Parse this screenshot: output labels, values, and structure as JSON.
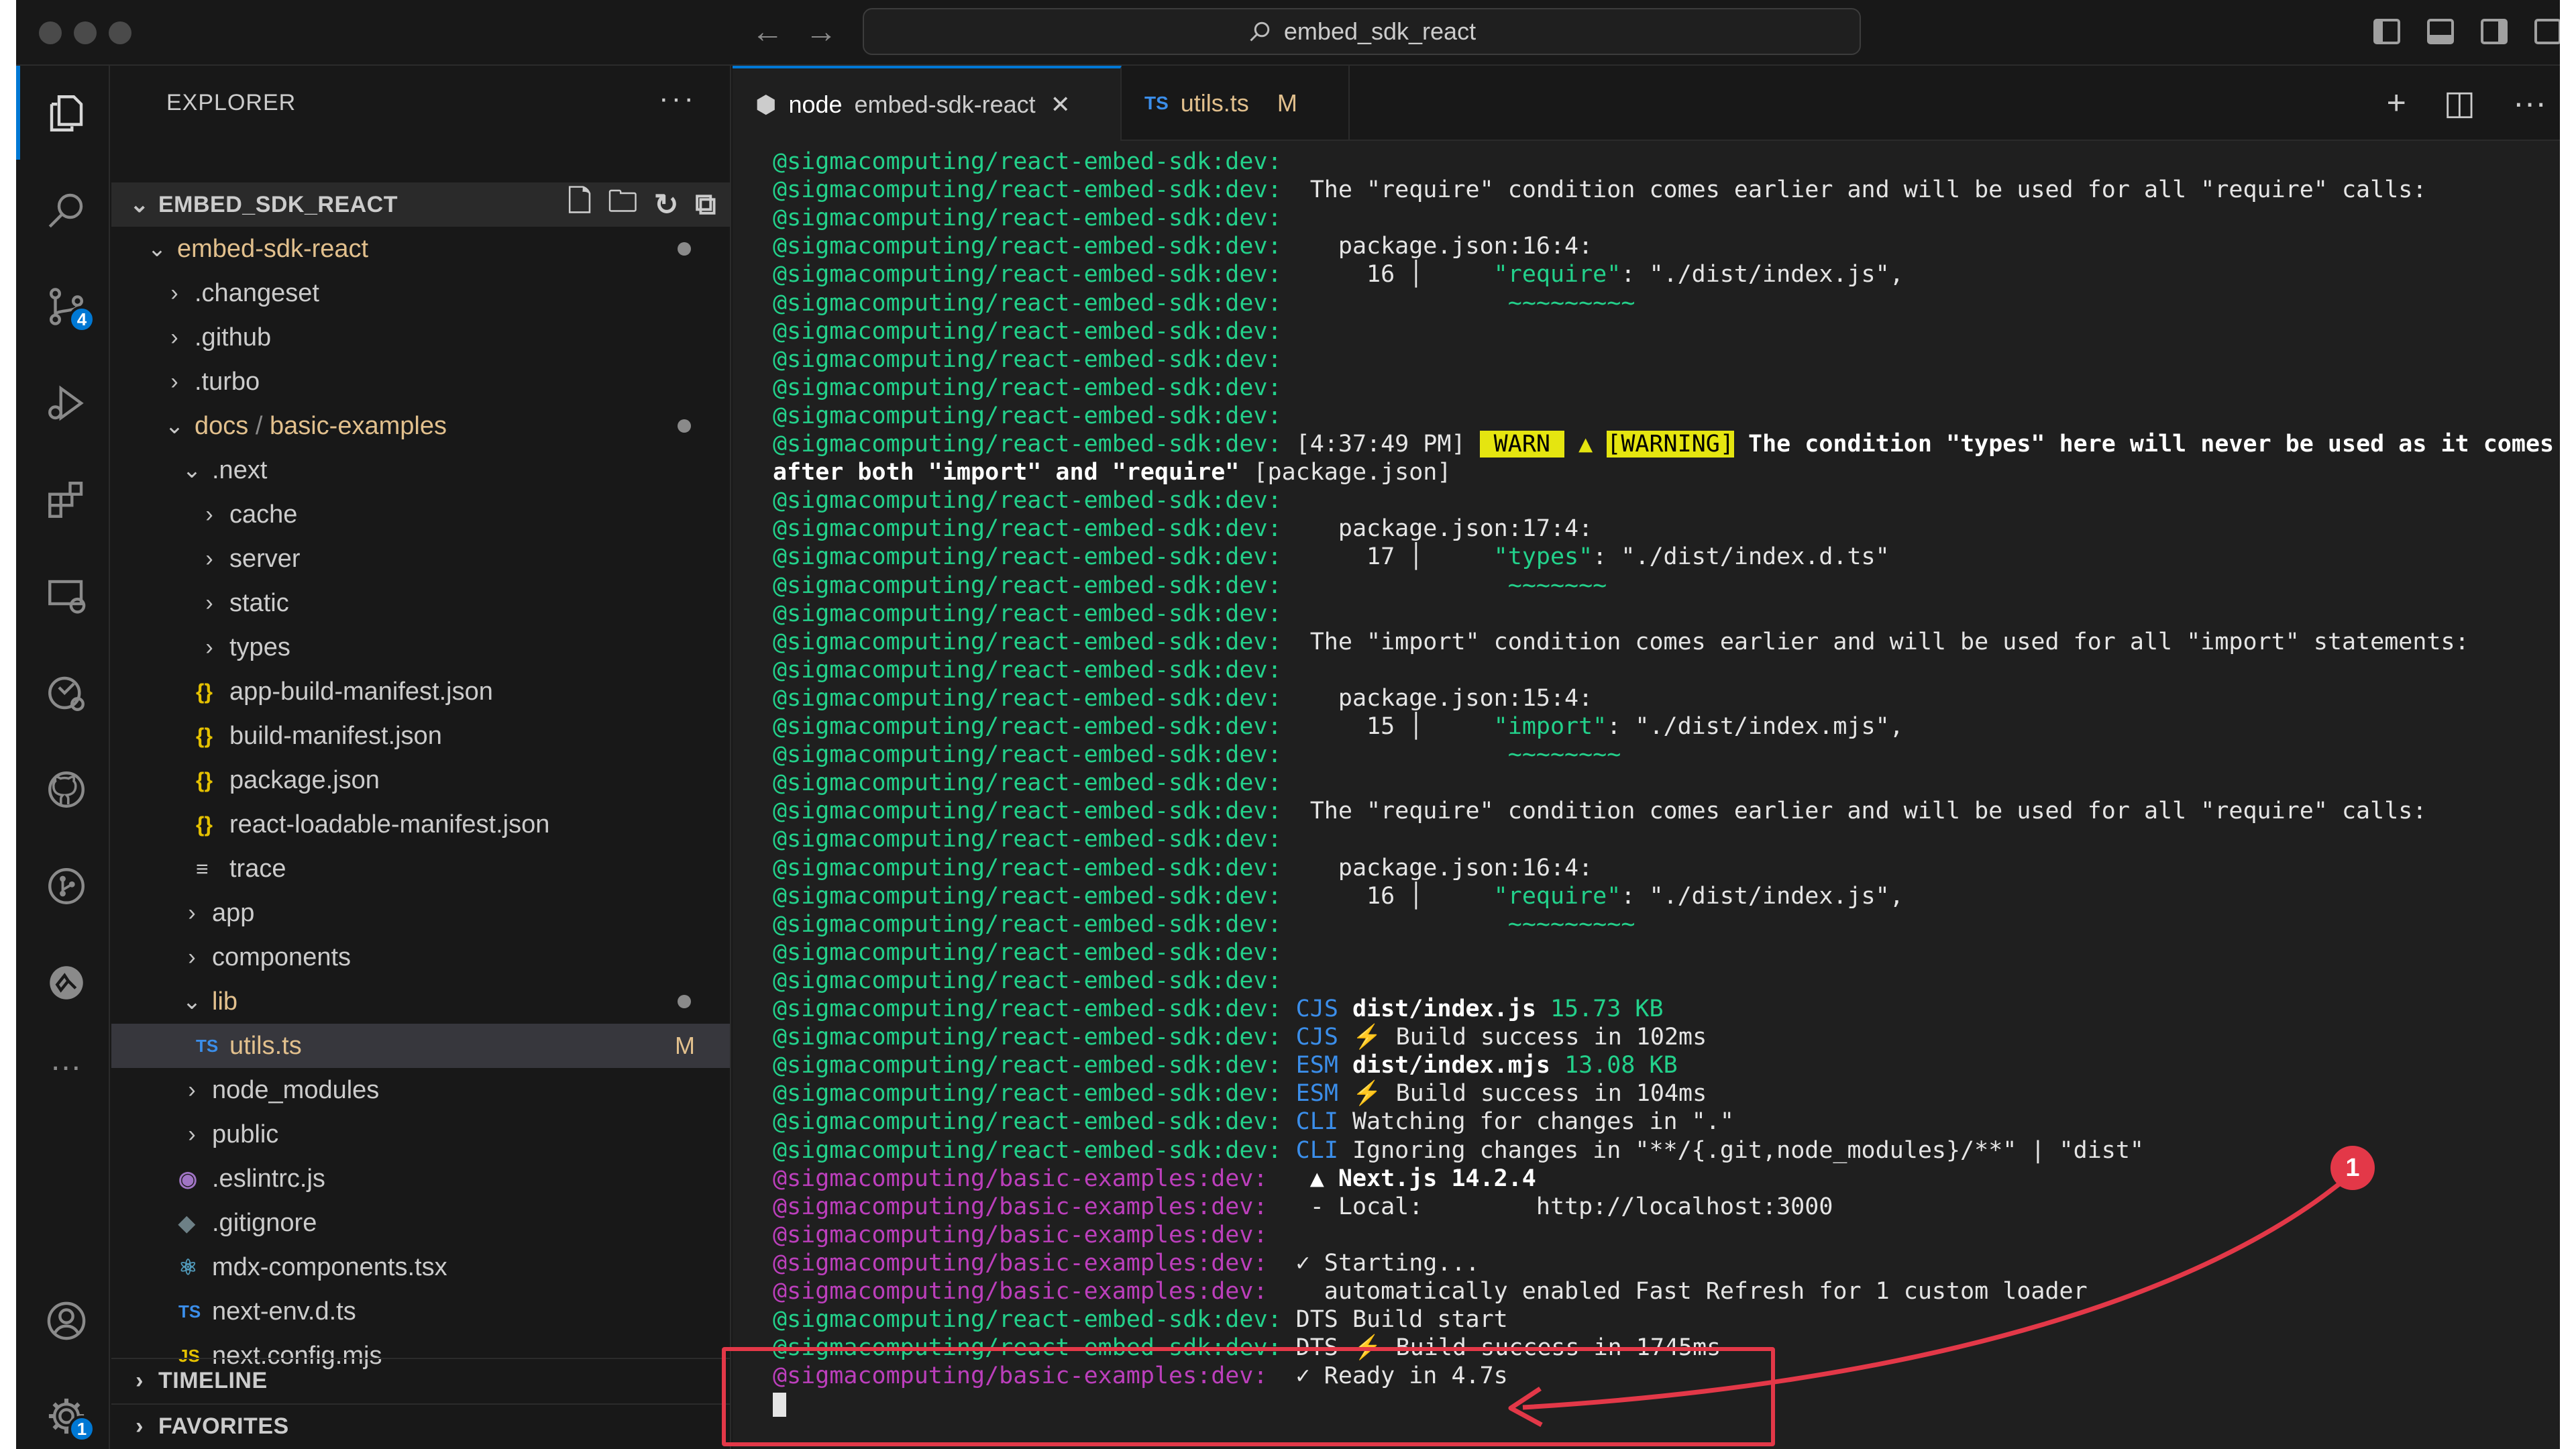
{
  "window": {
    "search_text": "embed_sdk_react"
  },
  "activity_bar": {
    "source_control_badge": "4",
    "settings_badge": "1",
    "more_label": "..."
  },
  "sidebar": {
    "header": "EXPLORER",
    "more": "···",
    "root": "EMBED_SDK_REACT",
    "tree": [
      {
        "label": "embed-sdk-react",
        "chev": "⌄",
        "color": "#e2c08d"
      },
      {
        "label": ".changeset",
        "chev": "›"
      },
      {
        "label": ".github",
        "chev": "›"
      },
      {
        "label": ".turbo",
        "chev": "›"
      },
      {
        "label": "docs",
        "sep": " / ",
        "label2": "basic-examples",
        "chev": "⌄",
        "color": "#e2c08d"
      },
      {
        "label": ".next",
        "chev": "⌄"
      },
      {
        "label": "cache",
        "chev": "›"
      },
      {
        "label": "server",
        "chev": "›"
      },
      {
        "label": "static",
        "chev": "›"
      },
      {
        "label": "types",
        "chev": "›"
      },
      {
        "label": "app-build-manifest.json",
        "icon": "{}"
      },
      {
        "label": "build-manifest.json",
        "icon": "{}"
      },
      {
        "label": "package.json",
        "icon": "{}"
      },
      {
        "label": "react-loadable-manifest.json",
        "icon": "{}"
      },
      {
        "label": "trace",
        "icon": "≡"
      },
      {
        "label": "app",
        "chev": "›"
      },
      {
        "label": "components",
        "chev": "›"
      },
      {
        "label": "lib",
        "chev": "⌄",
        "color": "#e2c08d"
      },
      {
        "label": "utils.ts",
        "icon": "TS",
        "status": "M",
        "color": "#e2c08d"
      },
      {
        "label": "node_modules",
        "chev": "›"
      },
      {
        "label": "public",
        "chev": "›"
      },
      {
        "label": ".eslintrc.js",
        "icon": "◉"
      },
      {
        "label": ".gitignore",
        "icon": "◆"
      },
      {
        "label": "mdx-components.tsx",
        "icon": "⚛"
      },
      {
        "label": "next-env.d.ts",
        "icon": "TS"
      },
      {
        "label": "next.config.mjs",
        "icon": "JS"
      }
    ],
    "timeline": "TIMELINE",
    "favorites": "FAVORITES"
  },
  "tabs": [
    {
      "icon": "⬢",
      "name": "node",
      "detail": "embed-sdk-react",
      "close": "✕"
    },
    {
      "icon": "TS",
      "name": "utils.ts",
      "status": "M"
    }
  ],
  "tab_actions": [
    "+",
    "◫",
    "···"
  ],
  "terminal": {
    "prefix_react": "@sigmacomputing/react-embed-sdk:dev:",
    "prefix_basic": "@sigmacomputing/basic-examples:dev:",
    "lines": [
      {
        "p": "react",
        "segs": [
          {
            "t": ""
          }
        ]
      },
      {
        "p": "react",
        "segs": [
          {
            "t": "  The \"require\" condition comes earlier and will be used for all \"require\" calls:"
          }
        ]
      },
      {
        "p": "react",
        "segs": [
          {
            "t": ""
          }
        ]
      },
      {
        "p": "react",
        "segs": [
          {
            "t": "    package.json:16:4:"
          }
        ]
      },
      {
        "p": "react",
        "segs": [
          {
            "t": "      16 │     "
          },
          {
            "t": "\"require\"",
            "c": "sq"
          },
          {
            "t": ": \"./dist/index.js\","
          }
        ]
      },
      {
        "p": "react",
        "segs": [
          {
            "t": "                ~~~~~~~~~",
            "c": "sq"
          }
        ]
      },
      {
        "p": "react",
        "segs": [
          {
            "t": ""
          }
        ]
      },
      {
        "p": "react",
        "segs": [
          {
            "t": ""
          }
        ]
      },
      {
        "p": "react",
        "segs": [
          {
            "t": ""
          }
        ]
      },
      {
        "p": "react",
        "segs": [
          {
            "t": ""
          }
        ]
      },
      {
        "p": "react",
        "segs": [
          {
            "t": " [4:37:49 PM] ",
            "c": "tc"
          },
          {
            "t": " WARN ",
            "c": "warn-badge"
          },
          {
            "t": " ▲ ",
            "c": "warnc"
          },
          {
            "t": "[WARNING]",
            "c": "warn-badge"
          },
          {
            "t": " The condition \"types\" here will never be used as it comes",
            "c": "bright"
          }
        ]
      },
      {
        "p": "none",
        "segs": [
          {
            "t": "after both \"import\" and \"require\"",
            "c": "bright"
          },
          {
            "t": " [package.json]"
          }
        ]
      },
      {
        "p": "react",
        "segs": [
          {
            "t": ""
          }
        ]
      },
      {
        "p": "react",
        "segs": [
          {
            "t": "    package.json:17:4:"
          }
        ]
      },
      {
        "p": "react",
        "segs": [
          {
            "t": "      17 │     "
          },
          {
            "t": "\"types\"",
            "c": "sq"
          },
          {
            "t": ": \"./dist/index.d.ts\""
          }
        ]
      },
      {
        "p": "react",
        "segs": [
          {
            "t": "                ~~~~~~~",
            "c": "sq"
          }
        ]
      },
      {
        "p": "react",
        "segs": [
          {
            "t": ""
          }
        ]
      },
      {
        "p": "react",
        "segs": [
          {
            "t": "  The \"import\" condition comes earlier and will be used for all \"import\" statements:"
          }
        ]
      },
      {
        "p": "react",
        "segs": [
          {
            "t": ""
          }
        ]
      },
      {
        "p": "react",
        "segs": [
          {
            "t": "    package.json:15:4:"
          }
        ]
      },
      {
        "p": "react",
        "segs": [
          {
            "t": "      15 │     "
          },
          {
            "t": "\"import\"",
            "c": "sq"
          },
          {
            "t": ": \"./dist/index.mjs\","
          }
        ]
      },
      {
        "p": "react",
        "segs": [
          {
            "t": "                ~~~~~~~~",
            "c": "sq"
          }
        ]
      },
      {
        "p": "react",
        "segs": [
          {
            "t": ""
          }
        ]
      },
      {
        "p": "react",
        "segs": [
          {
            "t": "  The \"require\" condition comes earlier and will be used for all \"require\" calls:"
          }
        ]
      },
      {
        "p": "react",
        "segs": [
          {
            "t": ""
          }
        ]
      },
      {
        "p": "react",
        "segs": [
          {
            "t": "    package.json:16:4:"
          }
        ]
      },
      {
        "p": "react",
        "segs": [
          {
            "t": "      16 │     "
          },
          {
            "t": "\"require\"",
            "c": "sq"
          },
          {
            "t": ": \"./dist/index.js\","
          }
        ]
      },
      {
        "p": "react",
        "segs": [
          {
            "t": "                ~~~~~~~~~",
            "c": "sq"
          }
        ]
      },
      {
        "p": "react",
        "segs": [
          {
            "t": ""
          }
        ]
      },
      {
        "p": "react",
        "segs": [
          {
            "t": ""
          }
        ]
      },
      {
        "p": "react",
        "segs": [
          {
            "t": " "
          },
          {
            "t": "CJS",
            "c": "cjs"
          },
          {
            "t": " "
          },
          {
            "t": "dist/index.js",
            "c": "bright"
          },
          {
            "t": " "
          },
          {
            "t": "15.73 KB",
            "c": "size"
          }
        ]
      },
      {
        "p": "react",
        "segs": [
          {
            "t": " "
          },
          {
            "t": "CJS",
            "c": "cjs"
          },
          {
            "t": " ⚡️ Build success in 102ms"
          }
        ]
      },
      {
        "p": "react",
        "segs": [
          {
            "t": " "
          },
          {
            "t": "ESM",
            "c": "cjs"
          },
          {
            "t": " "
          },
          {
            "t": "dist/index.mjs",
            "c": "bright"
          },
          {
            "t": " "
          },
          {
            "t": "13.08 KB",
            "c": "size"
          }
        ]
      },
      {
        "p": "react",
        "segs": [
          {
            "t": " "
          },
          {
            "t": "ESM",
            "c": "cjs"
          },
          {
            "t": " ⚡️ Build success in 104ms"
          }
        ]
      },
      {
        "p": "react",
        "segs": [
          {
            "t": " "
          },
          {
            "t": "CLI",
            "c": "cjs"
          },
          {
            "t": " Watching for changes in \".\""
          }
        ]
      },
      {
        "p": "react",
        "segs": [
          {
            "t": " "
          },
          {
            "t": "CLI",
            "c": "cjs"
          },
          {
            "t": " Ignoring changes in \"**/{.git,node_modules}/**\" | \"dist\""
          }
        ]
      },
      {
        "p": "basic",
        "segs": [
          {
            "t": "   ▲ Next.js 14.2.4",
            "c": "bright"
          }
        ]
      },
      {
        "p": "basic",
        "segs": [
          {
            "t": "   - Local:        http://localhost:3000"
          }
        ]
      },
      {
        "p": "basic",
        "segs": [
          {
            "t": ""
          }
        ]
      },
      {
        "p": "basic",
        "segs": [
          {
            "t": "  ✓ Starting..."
          }
        ]
      },
      {
        "p": "basic",
        "segs": [
          {
            "t": "    automatically enabled Fast Refresh for 1 custom loader"
          }
        ]
      },
      {
        "p": "react",
        "segs": [
          {
            "t": " DTS Build start"
          }
        ]
      },
      {
        "p": "react",
        "segs": [
          {
            "t": " DTS ⚡️ Build success in 1745ms"
          }
        ]
      },
      {
        "p": "basic",
        "segs": [
          {
            "t": "  ✓ Ready in 4.7s"
          }
        ]
      }
    ]
  },
  "annotation": {
    "badge": "1"
  },
  "colors": {
    "accent": "#0078d4",
    "annotation": "#e33848",
    "react_prefix": "#23d18b",
    "basic_prefix": "#bc3fbc",
    "warn": "#e5e510"
  }
}
